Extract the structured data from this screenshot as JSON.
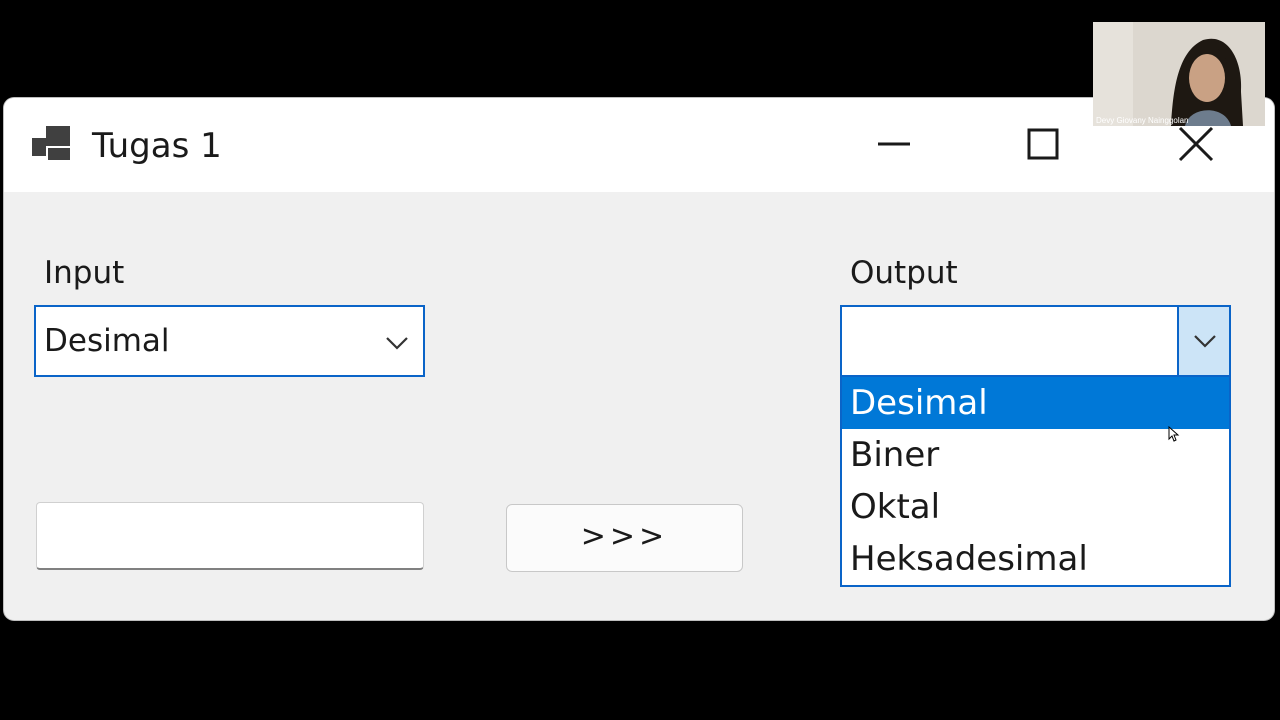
{
  "window": {
    "title": "Tugas 1",
    "icon": "application-window-icon"
  },
  "input_section": {
    "label": "Input",
    "combo_value": "Desimal"
  },
  "output_section": {
    "label": "Output",
    "combo_value": "",
    "dropdown_options": [
      "Desimal",
      "Biner",
      "Oktal",
      "Heksadesimal"
    ],
    "selected_option": "Desimal"
  },
  "value_field": {
    "value": ""
  },
  "convert_button": {
    "label": ">>>"
  },
  "webcam": {
    "participant_name": "Devy Giovany Nainggolan"
  },
  "colors": {
    "accent": "#0078d7",
    "focus_border": "#0a64c8",
    "window_bg": "#f0f0f0",
    "titlebar_bg": "#ffffff"
  }
}
